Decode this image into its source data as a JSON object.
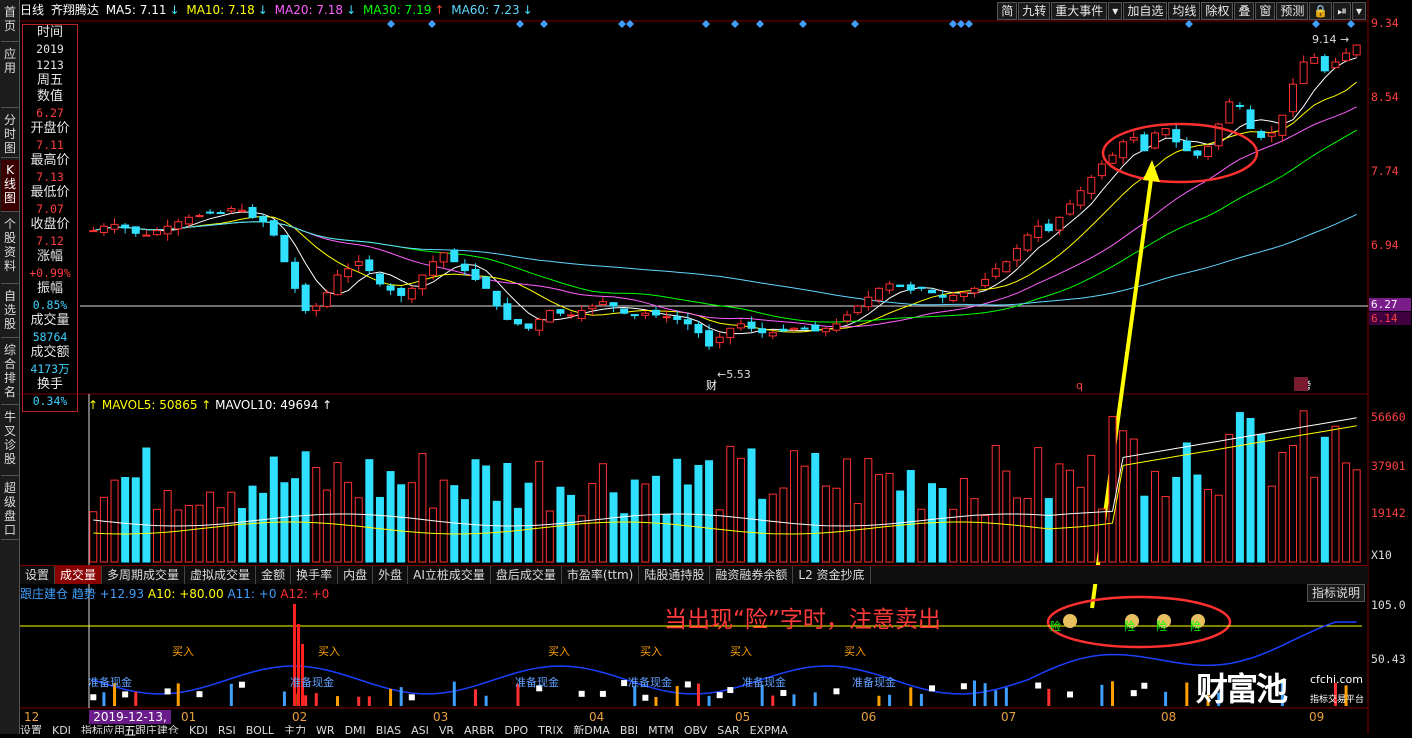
{
  "sidebar": {
    "tabs": [
      {
        "label": "首页",
        "active": false
      },
      {
        "label": "应用",
        "active": false
      },
      {
        "label": "分时图",
        "active": false
      },
      {
        "label": "K线图",
        "active": true
      },
      {
        "label": "个股资料",
        "active": false
      },
      {
        "label": "自选股",
        "active": false
      },
      {
        "label": "综合排名",
        "active": false
      },
      {
        "label": "牛叉诊股",
        "active": false
      },
      {
        "label": "超级盘口",
        "active": false
      }
    ]
  },
  "header": {
    "period": "日线",
    "stock_name": "齐翔腾达",
    "ma": [
      {
        "label": "MA5: 7.11",
        "dir": "↓",
        "color": "#ffffff"
      },
      {
        "label": "MA10: 7.18",
        "dir": "↓",
        "color": "#ffff00"
      },
      {
        "label": "MA20: 7.18",
        "dir": "↓",
        "color": "#ff60ff"
      },
      {
        "label": "MA30: 7.19",
        "dir": "↑",
        "color": "#00ff00"
      },
      {
        "label": "MA60: 7.23",
        "dir": "↓",
        "color": "#60d8ff"
      }
    ],
    "up_color": "#ff3030",
    "down_color": "#30e0ff"
  },
  "toolbar": {
    "buttons": [
      "简",
      "九转",
      "重大事件",
      "▾",
      "加自选",
      "均线",
      "除权",
      "叠",
      "窗",
      "预测",
      "🔒",
      "⏯",
      "▾"
    ]
  },
  "info_panel": {
    "rows": [
      {
        "k": "时间",
        "v": "2019",
        "v2": "1213",
        "v3": "周五"
      },
      {
        "k": "数值",
        "v": "6.27"
      },
      {
        "k": "开盘价",
        "v": "7.11"
      },
      {
        "k": "最高价",
        "v": "7.13"
      },
      {
        "k": "最低价",
        "v": "7.07"
      },
      {
        "k": "收盘价",
        "v": "7.12"
      },
      {
        "k": "涨幅",
        "v": "+0.99%"
      },
      {
        "k": "振幅",
        "v": "0.85%",
        "cyan": true
      },
      {
        "k": "成交量",
        "v": "58764",
        "cyan": true
      },
      {
        "k": "成交额",
        "v": "4173万",
        "cyan": true
      },
      {
        "k": "换手",
        "v": "0.34%",
        "cyan": true
      }
    ]
  },
  "price_axis": {
    "labels": [
      "9.34",
      "8.54",
      "7.74",
      "6.94",
      "6.14"
    ],
    "cursor_price": "6.27",
    "last_price": "6.14"
  },
  "chart_data": [
    {
      "type": "line",
      "title": "K线图",
      "xlabel": "",
      "ylabel": "",
      "ylim": [
        5.3,
        9.4
      ],
      "price_marks": [
        "9.14",
        "5.53"
      ],
      "event_marks": [
        "财",
        "q",
        "榜"
      ],
      "close": [
        7.05,
        7.1,
        7.12,
        7.08,
        7.02,
        7.0,
        7.05,
        7.1,
        7.15,
        7.2,
        7.22,
        7.25,
        7.25,
        7.3,
        7.28,
        7.2,
        7.15,
        7.0,
        6.7,
        6.4,
        6.15,
        6.2,
        6.35,
        6.55,
        6.62,
        6.7,
        6.6,
        6.45,
        6.38,
        6.32,
        6.4,
        6.55,
        6.7,
        6.8,
        6.7,
        6.6,
        6.5,
        6.4,
        6.2,
        6.05,
        6.0,
        5.95,
        6.05,
        6.15,
        6.12,
        6.1,
        6.15,
        6.2,
        6.25,
        6.2,
        6.12,
        6.1,
        6.12,
        6.1,
        6.08,
        6.05,
        6.0,
        5.9,
        5.75,
        5.85,
        5.95,
        6.0,
        5.95,
        5.9,
        5.9,
        5.92,
        5.95,
        5.95,
        5.92,
        5.95,
        6.0,
        6.1,
        6.2,
        6.3,
        6.4,
        6.45,
        6.42,
        6.38,
        6.4,
        6.35,
        6.3,
        6.32,
        6.35,
        6.4,
        6.5,
        6.62,
        6.7,
        6.85,
        7.0,
        7.1,
        7.05,
        7.2,
        7.35,
        7.5,
        7.65,
        7.8,
        7.9,
        8.05,
        8.1,
        7.95,
        8.15,
        8.2,
        8.05,
        7.95,
        7.9,
        8.0,
        8.25,
        8.5,
        8.45,
        8.2,
        8.1,
        8.15,
        8.35,
        8.7,
        8.95,
        9.0,
        8.85,
        8.95,
        9.05,
        9.14
      ],
      "volume_axis": [
        "56660",
        "37901",
        "19142",
        "X10"
      ],
      "mavol": [
        "MAVOL5: 50865",
        "MAVOL10: 49694"
      ]
    }
  ],
  "volume_tabs": [
    "设置",
    "成交量",
    "多周期成交量",
    "虚拟成交量",
    "金额",
    "换手率",
    "内盘",
    "外盘",
    "AI立桩成交量",
    "盘后成交量",
    "市盈率(ttm)",
    "陆股通持股",
    "融资融券余额",
    "L2 资金抄底"
  ],
  "indicator": {
    "name": "跟庄建仓",
    "params": [
      "趋势 +12.93",
      "A10: +80.00",
      "A11: +0",
      "A12: +0"
    ],
    "axis": [
      "105.0",
      "50.43"
    ],
    "help": "指标说明",
    "labels_buy": "买入",
    "labels_cash": "准备现金",
    "warn": "险"
  },
  "date_axis": {
    "labels": [
      "12",
      "01",
      "02",
      "03",
      "04",
      "05",
      "06",
      "07",
      "08",
      "09"
    ],
    "selected": "2019-12-13,五"
  },
  "bottom_tabs": [
    "设置",
    "KDJ",
    "指标应用",
    "跟庄建仓",
    "KDJ",
    "RSI",
    "BOLL",
    "主力",
    "WR",
    "DMI",
    "BIAS",
    "ASI",
    "VR",
    "ARBR",
    "DPO",
    "TRIX",
    "新DMA",
    "BBI",
    "MTM",
    "OBV",
    "SAR",
    "EXPMA"
  ],
  "annotation": {
    "text": "当出现“险”字时，注意卖出",
    "color": "#ff3a3a"
  },
  "logo": {
    "brand": "财富池",
    "url": "cfchi.com",
    "sub": "指标交易平台"
  }
}
